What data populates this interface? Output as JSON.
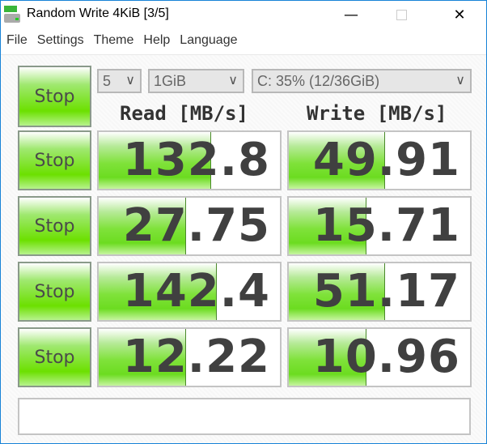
{
  "window": {
    "title": "Random Write 4KiB [3/5]",
    "minimize_icon": "minimize-icon",
    "maximize_icon": "maximize-icon",
    "close_icon": "close-icon"
  },
  "menu": [
    "File",
    "Settings",
    "Theme",
    "Help",
    "Language"
  ],
  "controls": {
    "all_button": "Stop",
    "count": "5",
    "size": "1GiB",
    "drive": "C: 35% (12/36GiB)"
  },
  "headers": {
    "read": "Read [MB/s]",
    "write": "Write [MB/s]"
  },
  "rows": [
    {
      "button": "Stop",
      "read": "132.8",
      "write": "49.91",
      "read_bar": 0.62,
      "write_bar": 0.53
    },
    {
      "button": "Stop",
      "read": "27.75",
      "write": "15.71",
      "read_bar": 0.48,
      "write_bar": 0.43
    },
    {
      "button": "Stop",
      "read": "142.4",
      "write": "51.17",
      "read_bar": 0.65,
      "write_bar": 0.53
    },
    {
      "button": "Stop",
      "read": "12.22",
      "write": "10.96",
      "read_bar": 0.48,
      "write_bar": 0.43
    }
  ],
  "status": "",
  "colors": {
    "accent_green": "#6ce000",
    "border": "#1883d7"
  }
}
